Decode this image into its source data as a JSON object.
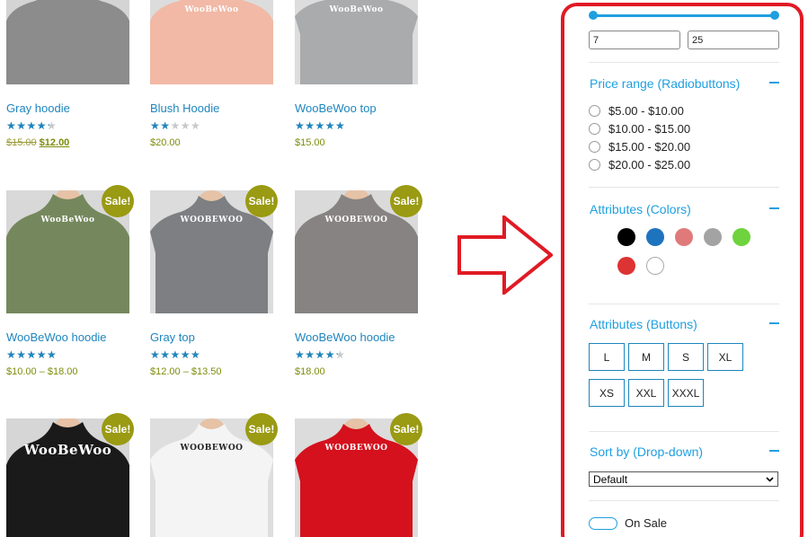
{
  "products": [
    {
      "title": "Gray hoodie",
      "rating": 4,
      "price_old": "$15.00",
      "price_new": "$12.00",
      "price": "",
      "sale": false,
      "garment_color": "#8c8c8c",
      "bg": "#d4d4d4",
      "logo": ""
    },
    {
      "title": "Blush Hoodie",
      "rating": 2,
      "price": "$20.00",
      "sale": false,
      "garment_color": "#f1b9a6",
      "bg": "#dcdcdc",
      "logo": "WooBeWoo"
    },
    {
      "title": "WooBeWoo top",
      "rating": 5,
      "price": "$15.00",
      "sale": false,
      "garment_color": "#a9abad",
      "bg": "#dddddd",
      "logo": "WooBeWoo"
    },
    {
      "title": "WooBeWoo hoodie",
      "rating": 5,
      "price": "$10.00 – $18.00",
      "sale": true,
      "garment_color": "#75885d",
      "bg": "#d8d8d8",
      "logo": "WooBeWoo"
    },
    {
      "title": "Gray top",
      "rating": 5,
      "price": "$12.00 – $13.50",
      "sale": true,
      "garment_color": "#7d7f82",
      "bg": "#dcdcdc",
      "logo": "WOOBEWOO"
    },
    {
      "title": "WooBeWoo hoodie",
      "rating": 4,
      "price": "$18.00",
      "sale": true,
      "garment_color": "#868382",
      "bg": "#dadada",
      "logo": "WOOBEWOO"
    },
    {
      "title": "",
      "rating": 0,
      "price": "",
      "sale": true,
      "garment_color": "#1a1a1a",
      "bg": "#d6d6d6",
      "logo": "WooBeWoo"
    },
    {
      "title": "",
      "rating": 0,
      "price": "",
      "sale": true,
      "garment_color": "#f4f4f4",
      "bg": "#dedede",
      "logo": "WOOBEWOO"
    },
    {
      "title": "",
      "rating": 0,
      "price": "",
      "sale": true,
      "garment_color": "#d4111d",
      "bg": "#dcdcdc",
      "logo": "WOOBEWOO"
    }
  ],
  "sale_label": "Sale!",
  "filter": {
    "range_min": "7",
    "range_max": "25",
    "price_range": {
      "title": "Price range (Radiobuttons)",
      "options": [
        "$5.00 - $10.00",
        "$10.00 - $15.00",
        "$15.00 - $20.00",
        "$20.00 - $25.00"
      ]
    },
    "colors": {
      "title": "Attributes (Colors)",
      "swatches": [
        "#000000",
        "#1e73be",
        "#e07a7a",
        "#a3a3a3",
        "#6ed33c",
        "#dd3333",
        "#ffffff"
      ]
    },
    "buttons": {
      "title": "Attributes (Buttons)",
      "sizes": [
        "L",
        "M",
        "S",
        "XL",
        "XS",
        "XXL",
        "XXXL"
      ]
    },
    "sort": {
      "title": "Sort by (Drop-down)",
      "selected": "Default"
    },
    "on_sale_label": "On Sale"
  },
  "colors": {
    "accent": "#1e9fe0",
    "link": "#1e85be",
    "price": "#7d8c0a",
    "border_highlight": "#e01a24",
    "sale_badge": "#9a9a13"
  }
}
